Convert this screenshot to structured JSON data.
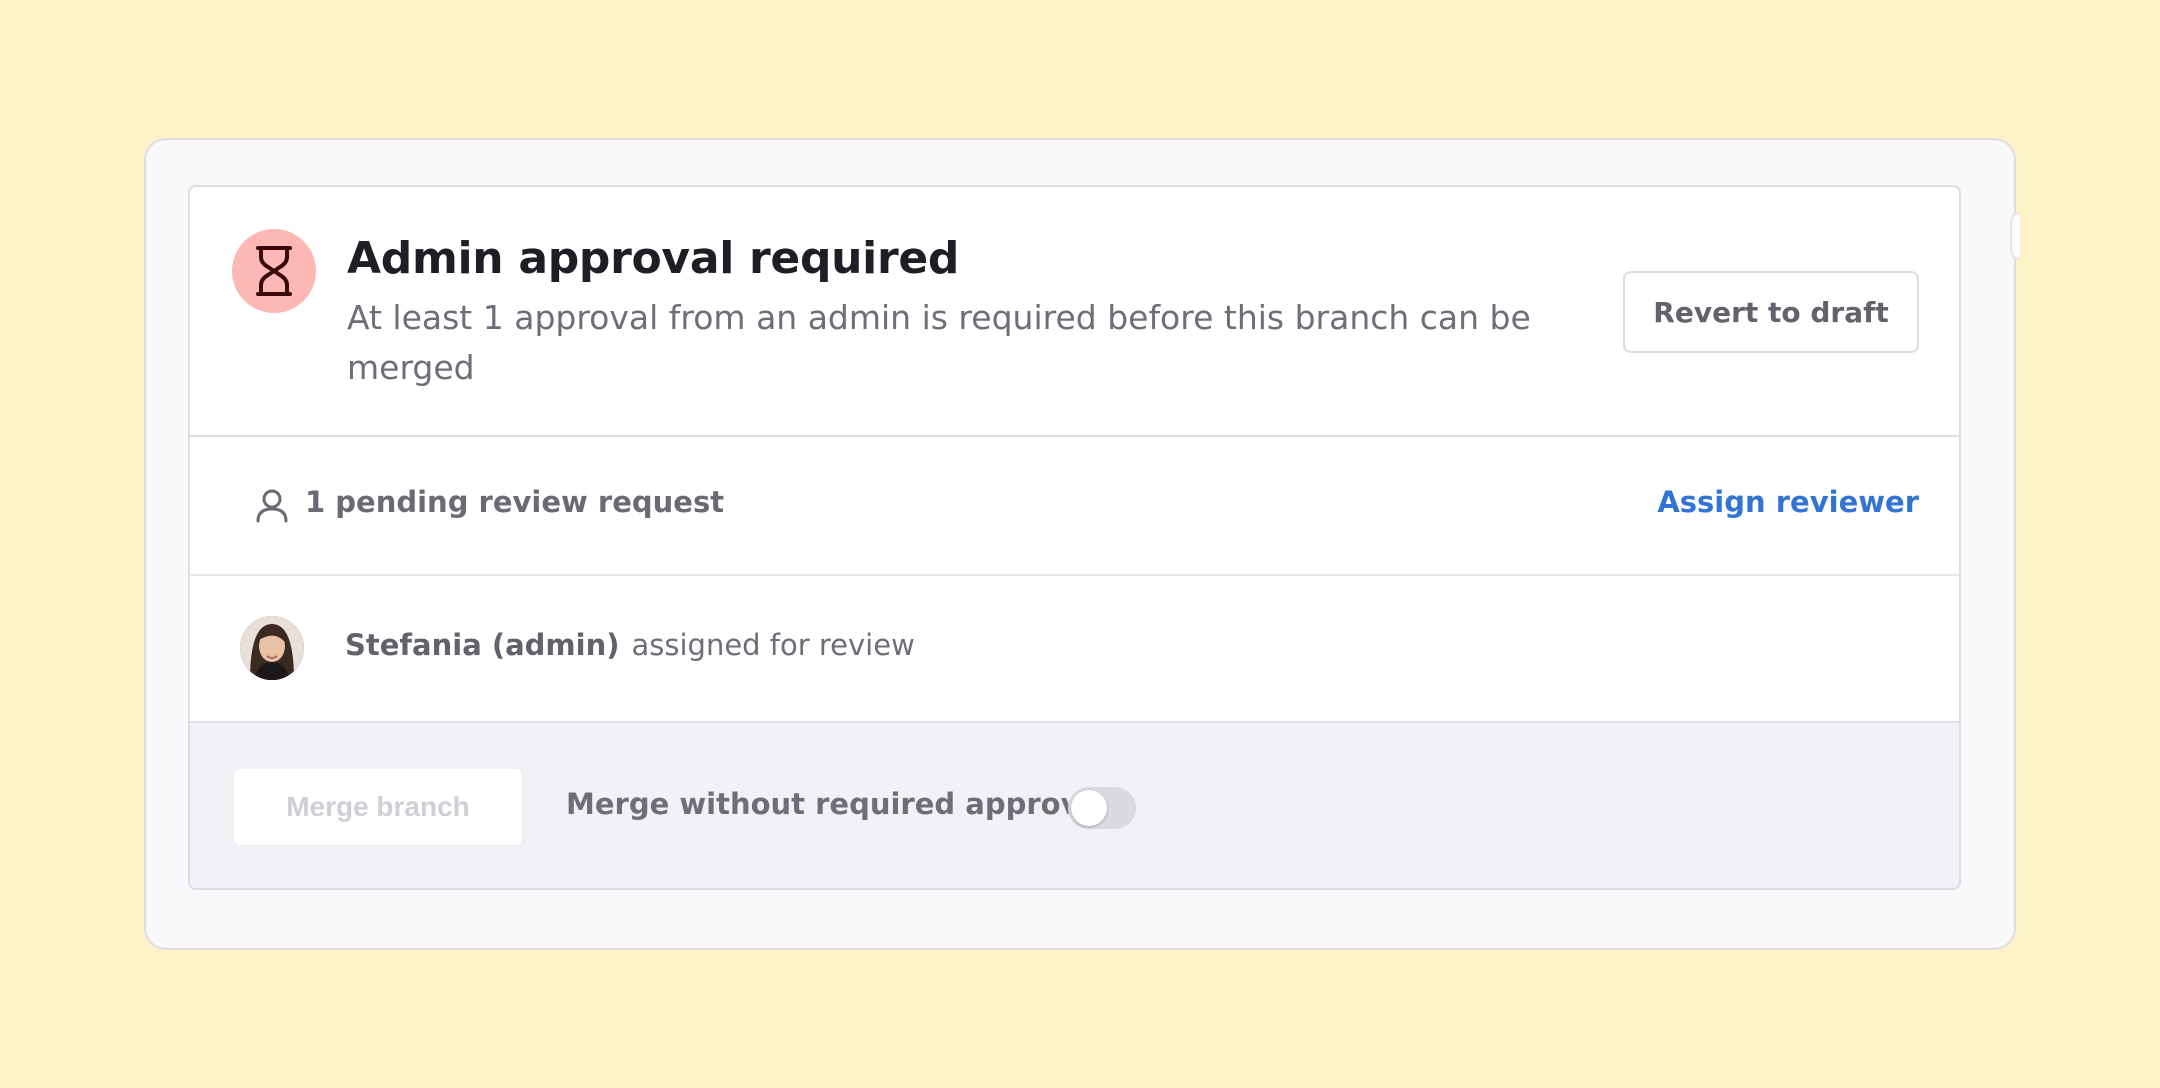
{
  "approval_panel": {
    "status_icon": "hourglass-icon",
    "title": "Admin approval required",
    "description": "At least 1 approval from an admin is required before this branch can be merged",
    "revert_button_label": "Revert to draft"
  },
  "review_requests": {
    "icon": "user-icon",
    "pending_label": "1 pending review request",
    "assign_link_label": "Assign reviewer"
  },
  "reviewer": {
    "name": "Stefania (admin)",
    "status_text": "assigned for review"
  },
  "merge_footer": {
    "merge_button_label": "Merge branch",
    "merge_button_disabled": true,
    "toggle_label": "Merge without required approval",
    "toggle_on": false
  },
  "colors": {
    "page_background": "#FEF2C8",
    "status_circle": "#FDB8B5",
    "link_accent": "#3274D4",
    "footer_background": "#F2F1F6"
  }
}
